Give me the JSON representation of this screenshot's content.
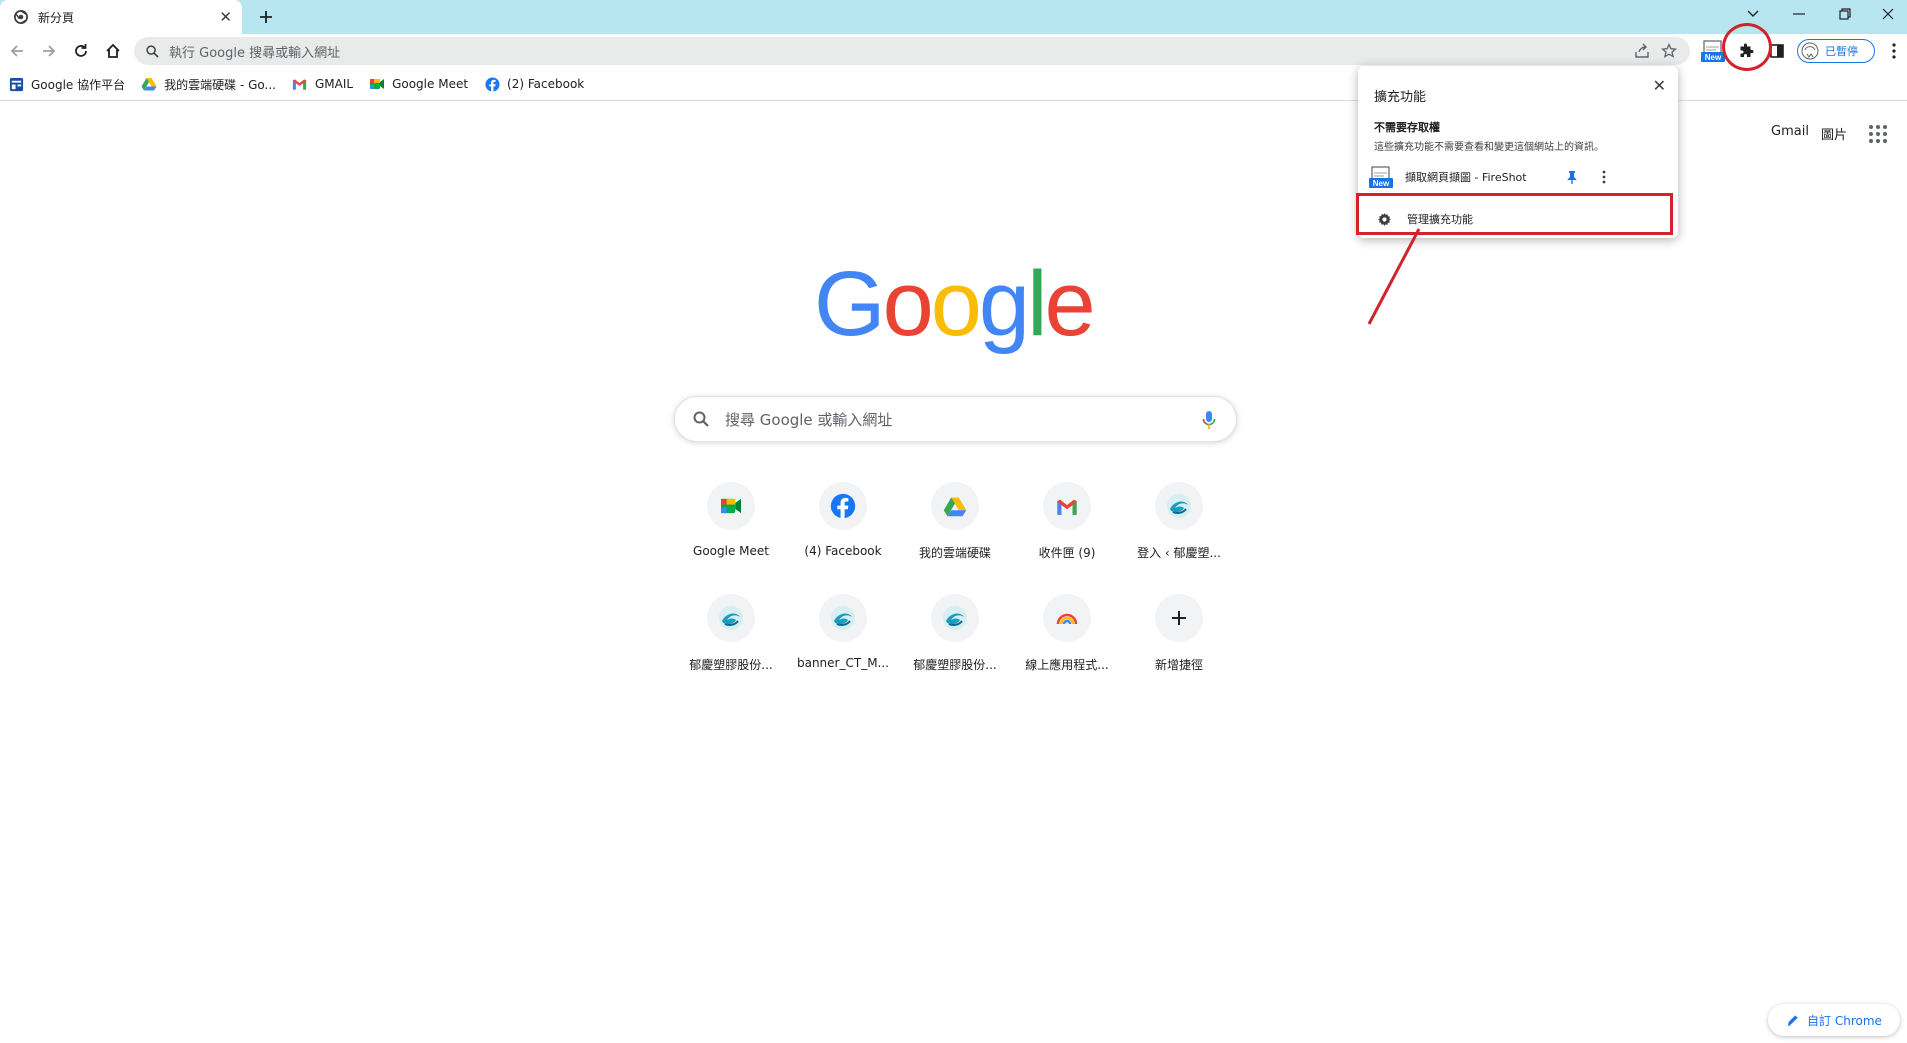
{
  "tab": {
    "title": "新分頁"
  },
  "omnibox": {
    "placeholder": "執行 Google 搜尋或輸入網址"
  },
  "profile": {
    "status": "已暫停"
  },
  "bookmarks": [
    {
      "label": "Google 協作平台",
      "icon": "google-sites-icon"
    },
    {
      "label": "我的雲端硬碟 - Go...",
      "icon": "google-drive-icon"
    },
    {
      "label": "GMAIL",
      "icon": "gmail-icon"
    },
    {
      "label": "Google Meet",
      "icon": "google-meet-icon"
    },
    {
      "label": "(2) Facebook",
      "icon": "facebook-icon"
    }
  ],
  "top_links": {
    "gmail": "Gmail",
    "images": "圖片"
  },
  "logo_text": "Google",
  "ntp_search": {
    "placeholder": "搜尋 Google 或輸入網址"
  },
  "shortcuts": [
    {
      "label": "Google Meet",
      "icon": "google-meet-icon"
    },
    {
      "label": "(4) Facebook",
      "icon": "facebook-icon"
    },
    {
      "label": "我的雲端硬碟",
      "icon": "google-drive-icon"
    },
    {
      "label": "收件匣 (9)",
      "icon": "gmail-icon"
    },
    {
      "label": "登入 ‹ 郁慶塑...",
      "icon": "site-swirl-icon"
    },
    {
      "label": "郁慶塑膠股份...",
      "icon": "site-swirl-icon"
    },
    {
      "label": "banner_CT_M...",
      "icon": "site-swirl-icon"
    },
    {
      "label": "郁慶塑膠股份...",
      "icon": "site-swirl-icon"
    },
    {
      "label": "線上應用程式...",
      "icon": "rainbow-icon"
    },
    {
      "label": "新增捷徑",
      "icon": "plus-icon"
    }
  ],
  "customize": {
    "label": "自訂 Chrome"
  },
  "extensions_popup": {
    "title": "擴充功能",
    "section_title": "不需要存取權",
    "section_desc": "這些擴充功能不需要查看和變更這個網站上的資訊。",
    "extension_name": "擷取網頁擷圖 - FireShot",
    "extension_badge": "New",
    "manage_label": "管理擴充功能"
  },
  "colors": {
    "tabstrip": "#b7e5f0",
    "annotation": "#d2232a",
    "accent": "#1a73e8"
  }
}
